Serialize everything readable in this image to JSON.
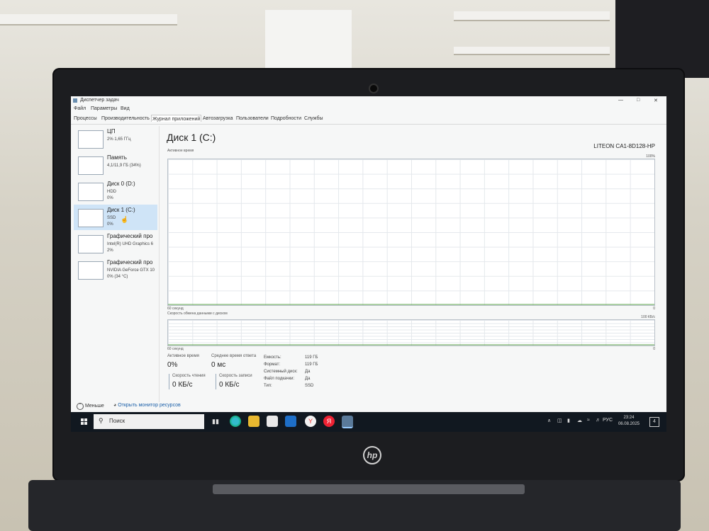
{
  "window": {
    "title": "Диспетчер задач"
  },
  "menu": [
    "Файл",
    "Параметры",
    "Вид"
  ],
  "tabs": [
    "Процессы",
    "Производительность",
    "Журнал приложений",
    "Автозагрузка",
    "Пользователи",
    "Подробности",
    "Службы"
  ],
  "active_tab": 1,
  "sidebar": [
    {
      "name": "ЦП",
      "line1": "2% 1,65 ГГц",
      "line2": ""
    },
    {
      "name": "Память",
      "line1": "4,1/11,9 ГБ (34%)",
      "line2": ""
    },
    {
      "name": "Диск 0 (D:)",
      "line1": "HDD",
      "line2": "0%"
    },
    {
      "name": "Диск 1 (C:)",
      "line1": "SSD",
      "line2": "0%"
    },
    {
      "name": "Графический про",
      "line1": "Intel(R) UHD Graphics 6",
      "line2": "2%"
    },
    {
      "name": "Графический про",
      "line1": "NVIDIA GeForce GTX 10",
      "line2": "0% (34 °C)"
    }
  ],
  "main": {
    "title": "Диск 1 (C:)",
    "model": "LITEON CA1-8D128-HP",
    "graph1": {
      "label": "Активное время",
      "max": "100%",
      "time": "60 секунд",
      "min": "0"
    },
    "graph2": {
      "label": "Скорость обмена данными с диском",
      "max": "100 КБ/с",
      "time": "60 секунд",
      "min": "0"
    },
    "stats": {
      "active_time_label": "Активное время",
      "active_time_value": "0%",
      "response_label": "Среднее время ответа",
      "response_value": "0 мс",
      "read_label": "Скорость чтения",
      "read_value": "0 КБ/с",
      "write_label": "Скорость записи",
      "write_value": "0 КБ/с"
    },
    "details": [
      {
        "k": "Емкость:",
        "v": "119 ГБ"
      },
      {
        "k": "Формат:",
        "v": "119 ГБ"
      },
      {
        "k": "Системный диск:",
        "v": "Да"
      },
      {
        "k": "Файл подкачки:",
        "v": "Да"
      },
      {
        "k": "Тип:",
        "v": "SSD"
      }
    ]
  },
  "footer": {
    "less": "Меньше",
    "monitor": "Открыть монитор ресурсов"
  },
  "taskbar": {
    "search": "Поиск",
    "lang": "РУС",
    "time": "23:24",
    "date": "06.08.2025",
    "notifications": "4"
  },
  "brand": {
    "logo_text": "hp"
  },
  "chart_data": {
    "type": "line",
    "series": [
      {
        "values": [
          0,
          0,
          0,
          0,
          0,
          0,
          0,
          0,
          0,
          0,
          0,
          0,
          0,
          0,
          0,
          0,
          0,
          0,
          0,
          0,
          0,
          0,
          0,
          0,
          0,
          0,
          0,
          0,
          0,
          0,
          0,
          0,
          0,
          0,
          0,
          0,
          0,
          0,
          0,
          0,
          0,
          0,
          0,
          0,
          0,
          0,
          0,
          0,
          0,
          0,
          0,
          0,
          0,
          0,
          0,
          0,
          0,
          0,
          0,
          0
        ]
      },
      {
        "values": [
          0,
          0,
          0,
          0,
          0,
          0,
          0,
          0,
          0,
          0,
          0,
          0,
          0,
          0,
          0,
          0,
          0,
          0,
          0,
          0,
          0,
          0,
          0,
          0,
          0,
          0,
          0,
          0,
          0,
          0,
          0,
          0,
          0,
          0,
          0,
          0,
          0,
          0,
          0,
          0,
          0,
          0,
          0,
          0,
          0,
          0,
          0,
          0,
          0,
          0,
          0,
          0,
          0,
          0,
          0,
          0,
          0,
          0,
          0,
          0
        ]
      }
    ]
  },
  "colors": {
    "accent": "#cfe4f7",
    "graph_line": "#5aa14a",
    "taskbar": "#111820"
  }
}
